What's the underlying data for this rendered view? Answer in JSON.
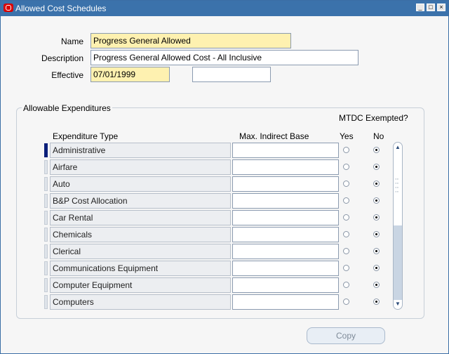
{
  "window": {
    "title": "Allowed Cost Schedules",
    "controls": {
      "minimize": "_",
      "maximize": "□",
      "close": "×"
    }
  },
  "form": {
    "name_label": "Name",
    "name_value": "Progress General Allowed",
    "description_label": "Description",
    "description_value": "Progress General Allowed Cost - All Inclusive",
    "effective_label": "Effective",
    "effective_from": "07/01/1999",
    "effective_to": ""
  },
  "expenditures": {
    "group_title": "Allowable Expenditures",
    "mtdc_title": "MTDC Exempted?",
    "columns": {
      "type": "Expenditure Type",
      "base": "Max. Indirect Base",
      "yes": "Yes",
      "no": "No"
    },
    "rows": [
      {
        "type": "Administrative",
        "base": "",
        "mtdc": "No",
        "current": true
      },
      {
        "type": "Airfare",
        "base": "",
        "mtdc": "No"
      },
      {
        "type": "Auto",
        "base": "",
        "mtdc": "No"
      },
      {
        "type": "B&P Cost Allocation",
        "base": "",
        "mtdc": "No"
      },
      {
        "type": "Car Rental",
        "base": "",
        "mtdc": "No"
      },
      {
        "type": "Chemicals",
        "base": "",
        "mtdc": "No"
      },
      {
        "type": "Clerical",
        "base": "",
        "mtdc": "No"
      },
      {
        "type": "Communications Equipment",
        "base": "",
        "mtdc": "No"
      },
      {
        "type": "Computer Equipment",
        "base": "",
        "mtdc": "No"
      },
      {
        "type": "Computers",
        "base": "",
        "mtdc": "No"
      }
    ]
  },
  "buttons": {
    "copy": "Copy"
  },
  "icons": {
    "app": "oracle-icon",
    "scroll_up": "▲",
    "scroll_down": "▼"
  }
}
